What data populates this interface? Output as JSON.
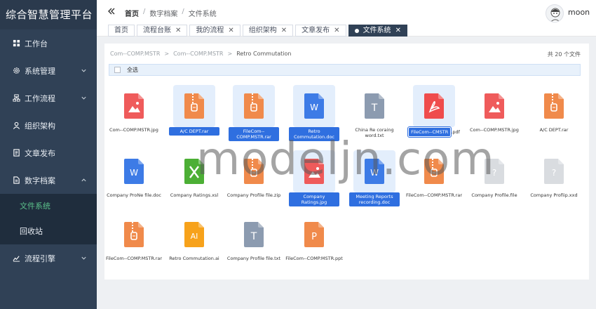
{
  "app": {
    "title": "综合智慧管理平台"
  },
  "sidebar": {
    "items": [
      {
        "label": "工作台",
        "icon": "dashboard-icon",
        "expandable": false
      },
      {
        "label": "系统管理",
        "icon": "gear-icon",
        "expandable": true
      },
      {
        "label": "工作流程",
        "icon": "workflow-icon",
        "expandable": true
      },
      {
        "label": "组织架构",
        "icon": "user-icon",
        "expandable": false
      },
      {
        "label": "文章发布",
        "icon": "document-icon",
        "expandable": false
      },
      {
        "label": "数字档案",
        "icon": "archive-icon",
        "expandable": true,
        "expanded": true
      }
    ],
    "sub_items": [
      {
        "label": "文件系统",
        "active": true
      },
      {
        "label": "回收站",
        "active": false
      }
    ],
    "last_item": {
      "label": "流程引擎",
      "icon": "engine-icon"
    }
  },
  "header": {
    "breadcrumb": [
      "首页",
      "数字档案",
      "文件系统"
    ],
    "separator": "/",
    "username": "moon"
  },
  "tags": [
    {
      "label": "首页",
      "closable": false,
      "active": false
    },
    {
      "label": "流程台账",
      "closable": true,
      "active": false
    },
    {
      "label": "我的流程",
      "closable": true,
      "active": false
    },
    {
      "label": "组织架构",
      "closable": true,
      "active": false
    },
    {
      "label": "文章发布",
      "closable": true,
      "active": false
    },
    {
      "label": "文件系统",
      "closable": true,
      "active": true
    }
  ],
  "explorer": {
    "path": [
      "Com--COMP.MSTR",
      "Com--COMP.MSTR",
      "Retro Commutation"
    ],
    "path_separator": ">",
    "count_label": "共 20 个文件",
    "select_all_label": "全选",
    "files": [
      {
        "name": "Com--COMP.MSTR.jpg",
        "type": "image",
        "color": "#ef5b5b",
        "selected": false
      },
      {
        "name": "A/C DEPT.rar",
        "type": "archive",
        "color": "#f08a4b",
        "selected": true
      },
      {
        "name": "FileCom--COMP.MSTR.rar",
        "type": "archive",
        "color": "#f08a4b",
        "selected": true
      },
      {
        "name": "Retro Commutation.doc",
        "type": "word",
        "color": "#3d7be6",
        "selected": true
      },
      {
        "name": "China Re coraing word.txt",
        "type": "text",
        "color": "#8c9bb0",
        "selected": false
      },
      {
        "name": "FileCom--CMSTR",
        "ext": ".pdf",
        "type": "pdf",
        "color": "#ef4c4c",
        "selected": true,
        "renaming": true
      },
      {
        "name": "Com--COMP.MSTR.jpg",
        "type": "image",
        "color": "#ef5b5b",
        "selected": false
      },
      {
        "name": "A/C DEPT.rar",
        "type": "archive",
        "color": "#f08a4b",
        "selected": false
      },
      {
        "name": "Company ProNe file.doc",
        "type": "word",
        "color": "#3d7be6",
        "selected": false
      },
      {
        "name": "Company Ratings.xsl",
        "type": "excel",
        "color": "#4caf35",
        "selected": false
      },
      {
        "name": "Company Profile file.zip",
        "type": "archive",
        "color": "#f08a4b",
        "selected": false
      },
      {
        "name": "Company Ratings.jpg",
        "type": "image",
        "color": "#ef5b5b",
        "selected": true
      },
      {
        "name": "Meeting Reports recording.doc",
        "type": "word",
        "color": "#3d7be6",
        "selected": true
      },
      {
        "name": "FileCom--COMP.MSTR.rar",
        "type": "archive",
        "color": "#f08a4b",
        "selected": false
      },
      {
        "name": "Company Profile.file",
        "type": "unknown",
        "color": "#d9dce0",
        "selected": false
      },
      {
        "name": "Company Profiip.xxd",
        "type": "unknown",
        "color": "#d9dce0",
        "selected": false
      },
      {
        "name": "FileCom--COMP.MSTR.rar",
        "type": "archive",
        "color": "#f08a4b",
        "selected": false
      },
      {
        "name": "Retro Commutation.ai",
        "type": "ai",
        "color": "#f7a21b",
        "selected": false
      },
      {
        "name": "Company Profile file.txt",
        "type": "text",
        "color": "#8c9bb0",
        "selected": false
      },
      {
        "name": "FileCom--COMP.MSTR.ppt",
        "type": "ppt",
        "color": "#f08a4b",
        "selected": false
      }
    ]
  },
  "watermark": "modeljn.com"
}
